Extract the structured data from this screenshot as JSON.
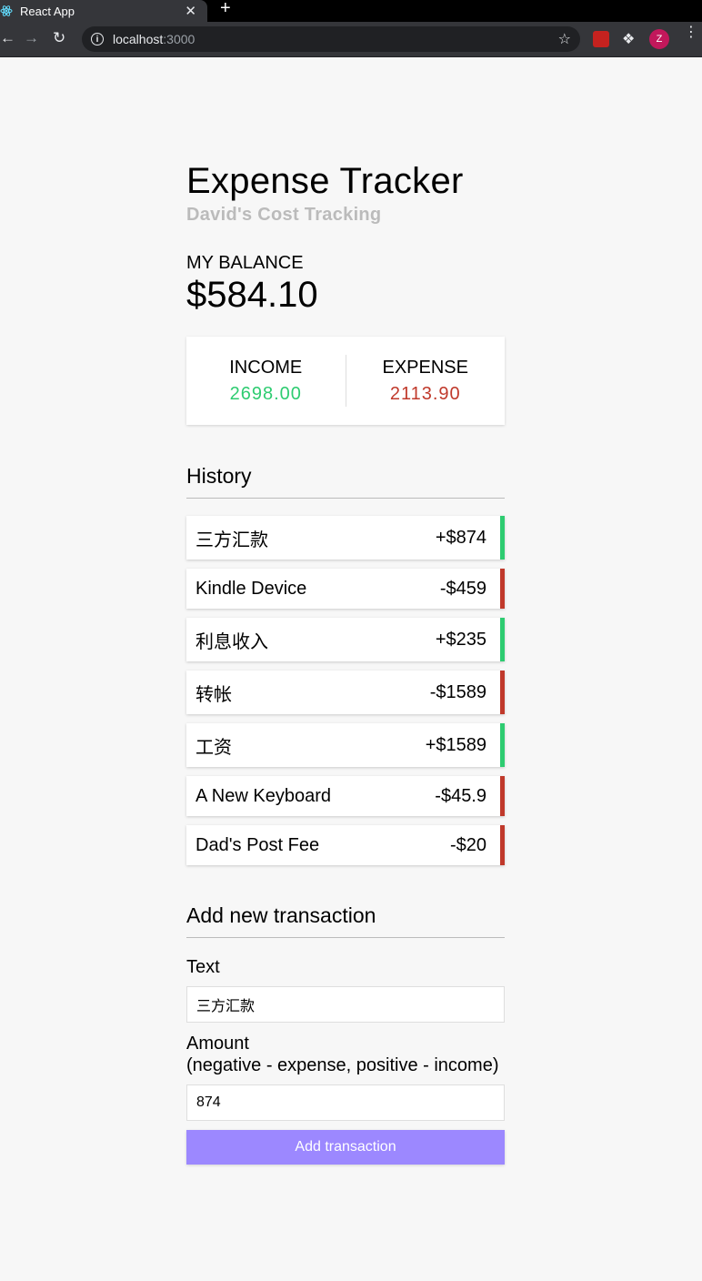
{
  "browser": {
    "tab_title": "React App",
    "tab_close": "✕",
    "new_tab": "+",
    "url_host": "localhost",
    "url_port": ":3000",
    "avatar_letter": "Z",
    "icons": [
      "react-favicon-icon",
      "back-icon",
      "forward-icon",
      "reload-icon",
      "info-icon",
      "star-icon",
      "extension-icon",
      "puzzle-icon",
      "menu-dots-icon"
    ]
  },
  "header": {
    "title": "Expense Tracker",
    "subtitle": "David's Cost Tracking"
  },
  "balance": {
    "label": "MY BALANCE",
    "value": "$584.10"
  },
  "summary": {
    "income_label": "INCOME",
    "income_value": "2698.00",
    "expense_label": "EXPENSE",
    "expense_value": "2113.90"
  },
  "history": {
    "title": "History",
    "items": [
      {
        "text": "三方汇款",
        "amount": "+$874",
        "type": "plus"
      },
      {
        "text": "Kindle Device",
        "amount": "-$459",
        "type": "minus"
      },
      {
        "text": "利息收入",
        "amount": "+$235",
        "type": "plus"
      },
      {
        "text": "转帐",
        "amount": "-$1589",
        "type": "minus"
      },
      {
        "text": "工资",
        "amount": "+$1589",
        "type": "plus"
      },
      {
        "text": "A New Keyboard",
        "amount": "-$45.9",
        "type": "minus"
      },
      {
        "text": "Dad's Post Fee",
        "amount": "-$20",
        "type": "minus"
      }
    ]
  },
  "form": {
    "title": "Add new transaction",
    "text_label": "Text",
    "text_value": "三方汇款",
    "amount_label": "Amount",
    "amount_hint": "(negative - expense, positive - income)",
    "amount_value": "874",
    "button_label": "Add transaction"
  },
  "colors": {
    "plus": "#2ecc71",
    "minus": "#c0392b",
    "button": "#9c88ff",
    "background": "#f7f7f7"
  }
}
